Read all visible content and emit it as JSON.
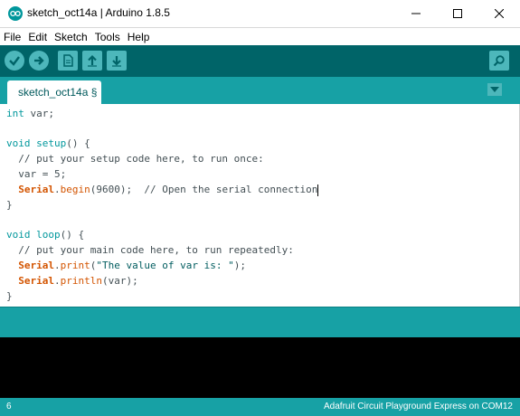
{
  "window": {
    "title": "sketch_oct14a | Arduino 1.8.5"
  },
  "icons": {
    "app": "arduino-logo-icon",
    "minimize": "minimize-icon",
    "maximize": "maximize-icon",
    "close": "close-icon",
    "verify": "checkmark-icon",
    "upload": "arrow-right-icon",
    "new": "new-file-icon",
    "open": "arrow-up-icon",
    "save": "arrow-down-icon",
    "serial_monitor": "magnifier-icon",
    "tab_menu": "triangle-down-icon"
  },
  "colors": {
    "toolbar": "#006468",
    "tabstrip": "#17a1a5",
    "keyword": "#00979c",
    "object": "#d35400"
  },
  "menu": [
    "File",
    "Edit",
    "Sketch",
    "Tools",
    "Help"
  ],
  "tab": {
    "label": "sketch_oct14a §"
  },
  "code": {
    "l1_type": "int",
    "l1_rest": " var;",
    "l3_type": "void",
    "l3_fn": "setup",
    "l3_rest": "() {",
    "l4": "  // put your setup code here, to run once:",
    "l5": "  var = 5;",
    "l6_indent": "  ",
    "l6_obj": "Serial",
    "l6_dot": ".",
    "l6_fn": "begin",
    "l6_rest": "(9600);  // Open the serial connection",
    "l7": "}",
    "l9_type": "void",
    "l9_fn": "loop",
    "l9_rest": "() {",
    "l10": "  // put your main code here, to run repeatedly:",
    "l11_indent": "  ",
    "l11_obj": "Serial",
    "l11_dot": ".",
    "l11_fn": "print",
    "l11_open": "(",
    "l11_str": "\"The value of var is: \"",
    "l11_close": ");",
    "l12_indent": "  ",
    "l12_obj": "Serial",
    "l12_dot": ".",
    "l12_fn": "println",
    "l12_rest": "(var);",
    "l13": "}"
  },
  "status": {
    "line_number": "6",
    "board": "Adafruit Circuit Playground Express on COM12"
  }
}
